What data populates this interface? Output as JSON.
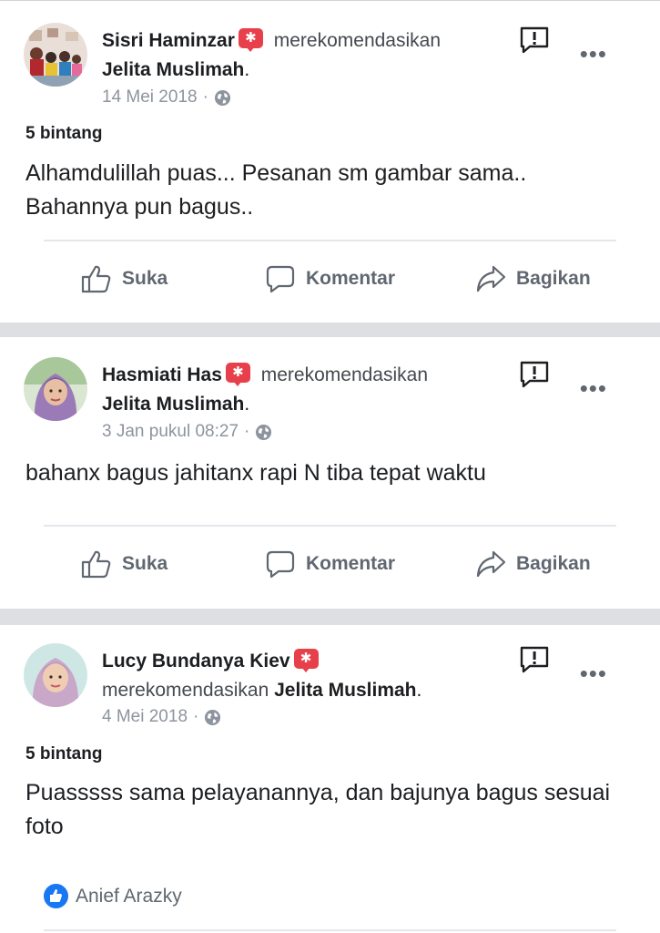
{
  "reviews": [
    {
      "reviewer": "Sisri Haminzar",
      "verb": "merekomendasikan",
      "page": "Jelita Muslimah",
      "date": "14 Mei 2018",
      "rating": "5 bintang",
      "text": "Alhamdulillah puas... Pesanan sm gambar sama.. Bahannya pun bagus.."
    },
    {
      "reviewer": "Hasmiati Has",
      "verb": "merekomendasikan",
      "page": "Jelita Muslimah",
      "date": "3 Jan pukul 08:27",
      "text": "bahanx bagus jahitanx rapi N tiba tepat waktu"
    },
    {
      "reviewer": "Lucy Bundanya Kiev",
      "verb": "merekomendasikan",
      "page": "Jelita Muslimah",
      "date": "4 Mei 2018",
      "rating": "5 bintang",
      "text": "Puasssss sama pelayanannya, dan bajunya bagus sesuai foto",
      "reactor": "Anief Arazky"
    }
  ],
  "actions": {
    "like": "Suka",
    "comment": "Komentar",
    "share": "Bagikan"
  },
  "separator": "·",
  "period": ".",
  "more": "•••",
  "icons": {
    "recommend_badge": "star-badge-icon",
    "report": "report-icon",
    "privacy": "globe-icon",
    "like": "thumbs-up-icon",
    "comment": "speech-bubble-icon",
    "share": "share-arrow-icon"
  },
  "colors": {
    "badge": "#e8404a",
    "like_reaction": "#1877f2",
    "secondary_text": "#606770",
    "meta_text": "#8d949e"
  }
}
